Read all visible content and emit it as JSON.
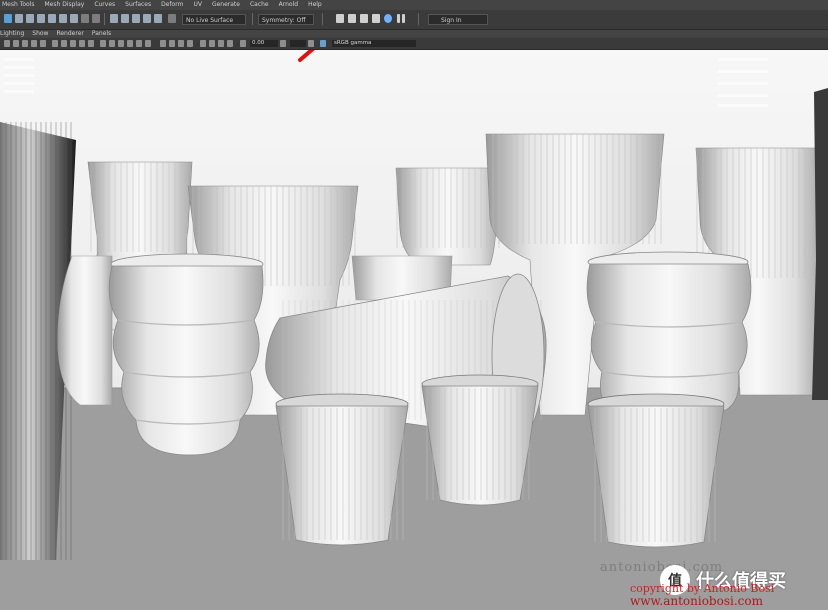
{
  "menu": [
    "Mesh Tools",
    "Mesh Display",
    "Curves",
    "Surfaces",
    "Deform",
    "UV",
    "Generate",
    "Cache",
    "Arnold",
    "Help"
  ],
  "status_line": {
    "live_surface": "No Live Surface",
    "symmetry": "Symmetry: Off",
    "sign_in": "Sign In"
  },
  "panel_menu": [
    "Lighting",
    "Show",
    "Renderer",
    "Panels"
  ],
  "viewport_toolbar": {
    "field_value": "0.00",
    "color_space": "sRGB gamma"
  },
  "watermark": {
    "site": "antoniobosi.com",
    "copyright": "copyright by Antonio Bosi",
    "url": "www.antoniobosi.com",
    "logo_char": "值",
    "logo_text": "什么值得买"
  },
  "colors": {
    "annotation_arrow": "#e01010",
    "floor": "#9c9c9c",
    "background": "#f4f4f4"
  }
}
